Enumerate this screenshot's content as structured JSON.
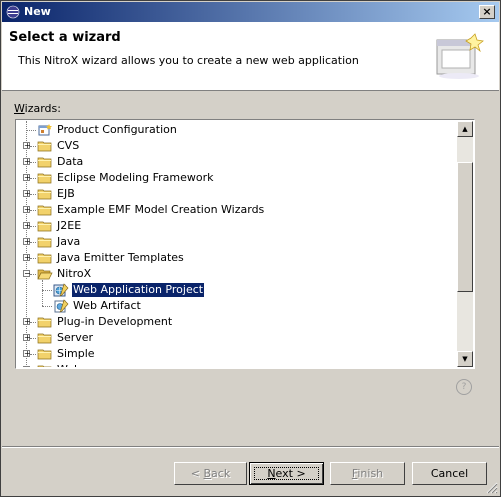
{
  "window": {
    "title": "New",
    "close_glyph": "×"
  },
  "banner": {
    "title": "Select a wizard",
    "description": "This NitroX wizard allows you to create a new web application",
    "image_icon": "wizard-banner-icon"
  },
  "wizards_label": {
    "prefix": "",
    "mnemonic": "W",
    "rest": "izards:"
  },
  "tree": {
    "items": [
      {
        "label": "Product Configuration",
        "icon": "product-config-icon",
        "level": 1,
        "expander": "none",
        "selected": false
      },
      {
        "label": "CVS",
        "icon": "folder-icon",
        "level": 0,
        "expander": "+",
        "selected": false
      },
      {
        "label": "Data",
        "icon": "folder-icon",
        "level": 0,
        "expander": "+",
        "selected": false
      },
      {
        "label": "Eclipse Modeling Framework",
        "icon": "folder-icon",
        "level": 0,
        "expander": "+",
        "selected": false
      },
      {
        "label": "EJB",
        "icon": "folder-icon",
        "level": 0,
        "expander": "+",
        "selected": false
      },
      {
        "label": "Example EMF Model Creation Wizards",
        "icon": "folder-icon",
        "level": 0,
        "expander": "+",
        "selected": false
      },
      {
        "label": "J2EE",
        "icon": "folder-icon",
        "level": 0,
        "expander": "+",
        "selected": false
      },
      {
        "label": "Java",
        "icon": "folder-icon",
        "level": 0,
        "expander": "+",
        "selected": false
      },
      {
        "label": "Java Emitter Templates",
        "icon": "folder-icon",
        "level": 0,
        "expander": "+",
        "selected": false
      },
      {
        "label": "NitroX",
        "icon": "folder-open-icon",
        "level": 0,
        "expander": "−",
        "selected": false
      },
      {
        "label": "Web Application Project",
        "icon": "web-project-icon",
        "level": 1,
        "expander": "none",
        "selected": true
      },
      {
        "label": "Web Artifact",
        "icon": "web-artifact-icon",
        "level": 1,
        "expander": "none",
        "selected": false
      },
      {
        "label": "Plug-in Development",
        "icon": "folder-icon",
        "level": 0,
        "expander": "+",
        "selected": false
      },
      {
        "label": "Server",
        "icon": "folder-icon",
        "level": 0,
        "expander": "+",
        "selected": false
      },
      {
        "label": "Simple",
        "icon": "folder-icon",
        "level": 0,
        "expander": "+",
        "selected": false
      },
      {
        "label": "Web",
        "icon": "folder-icon",
        "level": 0,
        "expander": "+",
        "selected": false
      }
    ],
    "scroll": {
      "up_glyph": "▲",
      "down_glyph": "▼",
      "position_fraction": 0.3
    }
  },
  "help_glyph": "?",
  "buttons": {
    "back": {
      "prefix": "< ",
      "mnemonic": "B",
      "rest": "ack",
      "enabled": false
    },
    "next": {
      "prefix": "",
      "mnemonic": "N",
      "rest": "ext >",
      "enabled": true
    },
    "finish": {
      "prefix": "",
      "mnemonic": "F",
      "rest": "inish",
      "enabled": false
    },
    "cancel": {
      "label": "Cancel",
      "enabled": true
    }
  },
  "colors": {
    "titlebar_start": "#0a246a",
    "titlebar_end": "#a6caf0",
    "selection": "#0a246a",
    "folder": "#f2d26b",
    "dialog_bg": "#d4d0c8"
  }
}
